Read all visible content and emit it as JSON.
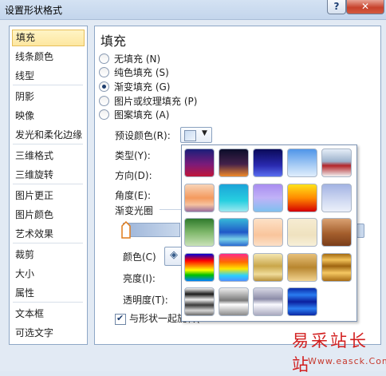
{
  "window": {
    "title": "设置形状格式",
    "help_label": "?",
    "close_label": "✕"
  },
  "sidebar": {
    "items": [
      {
        "label": "填充",
        "selected": true
      },
      {
        "label": "线条颜色"
      },
      {
        "label": "线型"
      },
      {
        "label": "阴影"
      },
      {
        "label": "映像"
      },
      {
        "label": "发光和柔化边缘"
      },
      {
        "label": "三维格式"
      },
      {
        "label": "三维旋转"
      },
      {
        "label": "图片更正"
      },
      {
        "label": "图片颜色"
      },
      {
        "label": "艺术效果"
      },
      {
        "label": "裁剪"
      },
      {
        "label": "大小"
      },
      {
        "label": "属性"
      },
      {
        "label": "文本框"
      },
      {
        "label": "可选文字"
      }
    ]
  },
  "fill": {
    "heading": "填充",
    "options": [
      {
        "label": "无填充 (N)",
        "selected": false
      },
      {
        "label": "纯色填充 (S)",
        "selected": false
      },
      {
        "label": "渐变填充 (G)",
        "selected": true
      },
      {
        "label": "图片或纹理填充 (P)",
        "selected": false
      },
      {
        "label": "图案填充 (A)",
        "selected": false
      }
    ],
    "preset_label": "预设颜色(R):",
    "type_label": "类型(Y):",
    "direction_label": "方向(D):",
    "angle_label": "角度(E):",
    "stops_label": "渐变光圈",
    "color_label": "颜色(C)",
    "brightness_label": "亮度(I):",
    "transparency_label": "透明度(T):",
    "rotate_checkbox_label": "与形状一起旋转(W)",
    "rotate_checked": true
  },
  "presets": {
    "tiles": [
      {
        "name": "Early Sunset",
        "gradient": "linear-gradient(#1a1f7a,#7a1b7a 55%,#c0163a)"
      },
      {
        "name": "Late Sunset",
        "gradient": "linear-gradient(#0b0d2a,#44214a 55%,#f08a2a)"
      },
      {
        "name": "Nightfall",
        "gradient": "linear-gradient(#0a0a5a,#2a2ab0 60%,#5a6ef0)"
      },
      {
        "name": "Daybreak",
        "gradient": "linear-gradient(#4f95e8,#a9cdf5 60%,#e0eefc)"
      },
      {
        "name": "Horizon",
        "gradient": "linear-gradient(#e5edf7,#9db2cc 45%,#b3262a 60%,#f2f2f2)"
      },
      {
        "name": "Desert",
        "gradient": "linear-gradient(#f8d4b8,#f49a5e 50%,#f6c2a0 75%,#9a6c9c)"
      },
      {
        "name": "Ocean",
        "gradient": "linear-gradient(#1ba4d8,#27cfe0 60%,#9ce8ef)"
      },
      {
        "name": "Calm Water",
        "gradient": "linear-gradient(#a98df0,#c0b2f7 50%,#7ec0ef)"
      },
      {
        "name": "Fire",
        "gradient": "linear-gradient(#ffe31a,#ff8a00 50%,#d40000)"
      },
      {
        "name": "Fog",
        "gradient": "linear-gradient(#a3b3e3,#d1daf2 60%,#ecf0fa)"
      },
      {
        "name": "Moss",
        "gradient": "linear-gradient(#2f7a2c,#7fb86b 50%,#c9e2b8)"
      },
      {
        "name": "Peacock",
        "gradient": "linear-gradient(#36b8d8,#2058c8 50%,#78d0e8 75%,#2a6ad0)"
      },
      {
        "name": "Wheat",
        "gradient": "linear-gradient(#fde1c6,#f9c59c 60%,#fce0c8)"
      },
      {
        "name": "Parchment",
        "gradient": "linear-gradient(#f6ecd2,#efe2bf 60%,#f7efd9)"
      },
      {
        "name": "Mahogany",
        "gradient": "linear-gradient(#d9a172,#a45e2c 55%,#7a3d1a)"
      },
      {
        "name": "Rainbow",
        "gradient": "linear-gradient(#0000d8,#ff0000 25%,#ff8c00 45%,#ffff00 60%,#00c000 78%,#0080ff)"
      },
      {
        "name": "Rainbow II",
        "gradient": "linear-gradient(#ff2a8a,#ff6a00 30%,#ffe600 55%,#28d0ff 80%,#5090ff)"
      },
      {
        "name": "Gold",
        "gradient": "linear-gradient(#f4e6b0,#c9a64a 45%,#f0dc9a 75%,#b8913a)"
      },
      {
        "name": "Gold II",
        "gradient": "linear-gradient(#e7c07a,#b8862f 50%,#f2d38f)"
      },
      {
        "name": "Brass",
        "gradient": "linear-gradient(#a36a12,#f2c25a 22%,#9e6410 45%,#f5c862 70%,#a76c14)"
      },
      {
        "name": "Chrome",
        "gradient": "linear-gradient(#f2f2f2,#1a1a1a 22%,#eeeeee 42%,#3a3a3a 62%,#d6d6d6 82%,#6a6a6a)"
      },
      {
        "name": "Chrome II",
        "gradient": "linear-gradient(#eeeeee,#7a7a7a 45%,#ffffff 60%,#8a8a8a)"
      },
      {
        "name": "Silver",
        "gradient": "linear-gradient(#d8d8e6,#8c8ca8 40%,#fafaff 60%,#a8a8be)"
      },
      {
        "name": "Sapphire",
        "gradient": "linear-gradient(#0a2aa8,#2a7cf0 25%,#0b1f9e 50%,#2c7ff2 75%,#0b28a6)"
      }
    ]
  },
  "watermark": {
    "main": "易采站长站",
    "sub": "Www.easck.Com"
  }
}
